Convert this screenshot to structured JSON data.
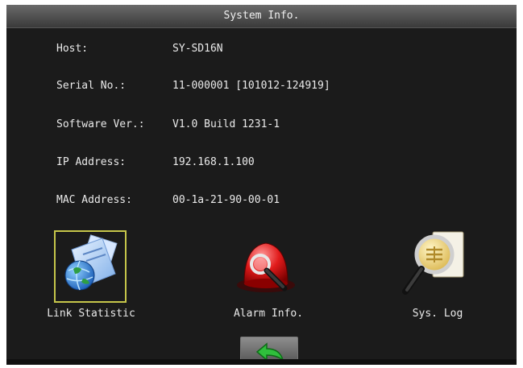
{
  "window": {
    "title": "System Info."
  },
  "info": [
    {
      "label": "Host:",
      "value": "SY-SD16N"
    },
    {
      "label": "Serial No.:",
      "value": "11-000001 [101012-124919]"
    },
    {
      "label": "Software Ver.:",
      "value": "V1.0 Build 1231-1"
    },
    {
      "label": "IP Address:",
      "value": "192.168.1.100"
    },
    {
      "label": "MAC Address:",
      "value": "00-1a-21-90-00-01"
    }
  ],
  "tiles": [
    {
      "label": "Link Statistic",
      "icon": "globe-document-icon",
      "selected": true
    },
    {
      "label": "Alarm Info.",
      "icon": "alarm-siren-icon",
      "selected": false
    },
    {
      "label": "Sys. Log",
      "icon": "magnifier-log-icon",
      "selected": false
    }
  ],
  "footer": {
    "back_icon": "back-arrow-icon"
  },
  "colors": {
    "accent_selected": "#c6c64a",
    "background": "#1b1b1b"
  }
}
